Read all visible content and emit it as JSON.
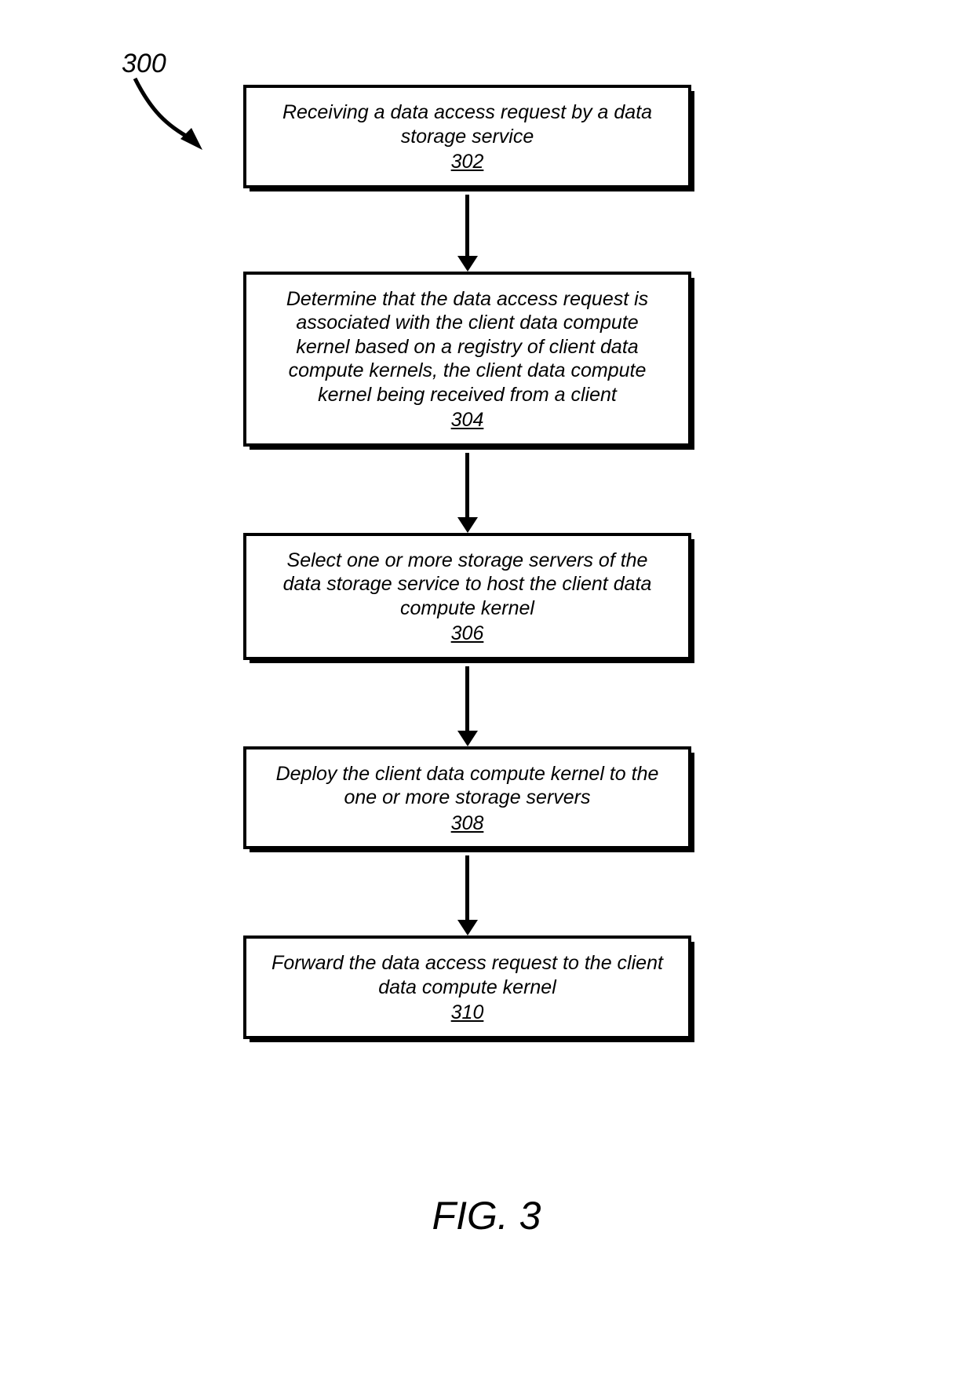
{
  "reference_number": "300",
  "figure_caption": "FIG. 3",
  "steps": [
    {
      "text": "Receiving a data access request by a data storage service",
      "num": "302"
    },
    {
      "text": "Determine that the data access request is associated with the client data compute kernel based on a registry of client data compute kernels, the client data compute kernel being received from a client",
      "num": "304"
    },
    {
      "text": "Select one or more storage servers of the data storage service to host the client data compute kernel",
      "num": "306"
    },
    {
      "text": "Deploy the client data compute kernel to the one or more storage servers",
      "num": "308"
    },
    {
      "text": "Forward the data access request to the client data compute kernel",
      "num": "310"
    }
  ],
  "connector_heights": [
    78,
    82,
    82,
    82
  ]
}
